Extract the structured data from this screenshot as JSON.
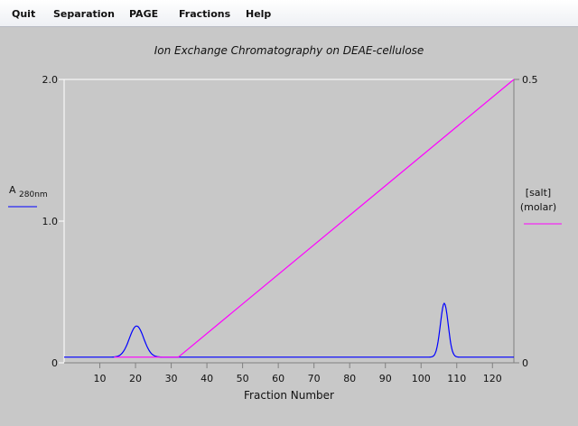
{
  "menu": {
    "items": [
      "Quit",
      "Separation",
      "PAGE",
      "Fractions",
      "Help"
    ]
  },
  "chart_data": {
    "type": "line",
    "title": "Ion Exchange Chromatography on DEAE-cellulose",
    "xlabel": "Fraction Number",
    "xlim": [
      0,
      126
    ],
    "x_ticks": [
      10,
      20,
      30,
      40,
      50,
      60,
      70,
      80,
      90,
      100,
      110,
      120
    ],
    "left_axis": {
      "label_main": "A",
      "label_sub": "280nm",
      "ylim": [
        0,
        2.0
      ],
      "ticks": [
        {
          "v": 0,
          "label": "0"
        },
        {
          "v": 1.0,
          "label": "1.0"
        },
        {
          "v": 2.0,
          "label": "2.0"
        }
      ],
      "color": "#0000ff"
    },
    "right_axis": {
      "label_line1": "[salt]",
      "label_line2": "(molar)",
      "ylim": [
        0,
        0.5
      ],
      "ticks": [
        {
          "v": 0,
          "label": "0"
        },
        {
          "v": 0.5,
          "label": "0.5"
        }
      ],
      "color": "#ff00ff"
    },
    "series": [
      {
        "axis": "left",
        "color": "#0000ff",
        "baseline": 0.04,
        "peaks": [
          {
            "center": 20.3,
            "height": 0.22,
            "sigma": 2.0
          },
          {
            "center": 106.5,
            "height": 0.38,
            "sigma": 1.1
          }
        ],
        "x_start": 0,
        "x_end": 126
      },
      {
        "axis": "right",
        "color": "#ff00ff",
        "points": [
          [
            14,
            0.01
          ],
          [
            32,
            0.01
          ],
          [
            126,
            0.5
          ]
        ]
      }
    ],
    "grid": false
  }
}
